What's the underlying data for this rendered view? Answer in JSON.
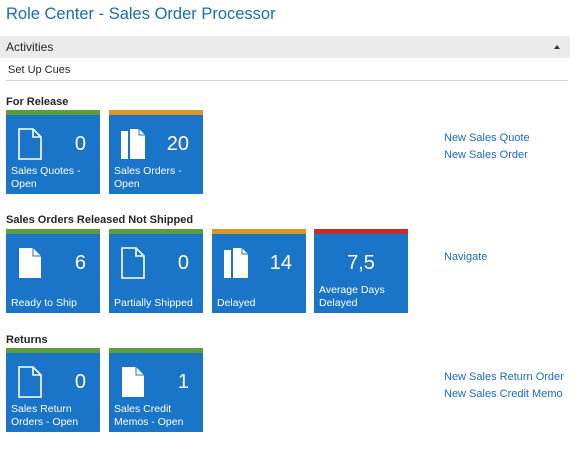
{
  "title": "Role Center - Sales Order Processor",
  "activities": {
    "label": "Activities",
    "setup_cues": "Set Up Cues"
  },
  "colors": {
    "green": "#5a9e3e",
    "orange": "#d9962b",
    "red": "#c0302b",
    "tile": "#1a74c7",
    "link": "#1c6cb4"
  },
  "groups": [
    {
      "title": "For Release",
      "tiles": [
        {
          "value": "0",
          "label": "Sales Quotes - Open",
          "icon": "document-icon",
          "status": "green"
        },
        {
          "value": "20",
          "label": "Sales Orders - Open",
          "icon": "documents-stack-icon",
          "status": "orange"
        }
      ],
      "actions": [
        "New Sales Quote",
        "New Sales Order"
      ]
    },
    {
      "title": "Sales Orders Released Not Shipped",
      "tiles": [
        {
          "value": "6",
          "label": "Ready to Ship",
          "icon": "document-filled-icon",
          "status": "green"
        },
        {
          "value": "0",
          "label": "Partially Shipped",
          "icon": "document-icon",
          "status": "green"
        },
        {
          "value": "14",
          "label": "Delayed",
          "icon": "documents-stack-icon",
          "status": "orange"
        },
        {
          "value": "7,5",
          "label": "Average Days Delayed",
          "icon": "",
          "status": "red"
        }
      ],
      "actions": [
        "Navigate"
      ]
    },
    {
      "title": "Returns",
      "tiles": [
        {
          "value": "0",
          "label": "Sales Return Orders - Open",
          "icon": "document-icon",
          "status": "green"
        },
        {
          "value": "1",
          "label": "Sales Credit Memos - Open",
          "icon": "document-filled-icon",
          "status": "green"
        }
      ],
      "actions": [
        "New Sales Return Order",
        "New Sales Credit Memo"
      ]
    }
  ]
}
